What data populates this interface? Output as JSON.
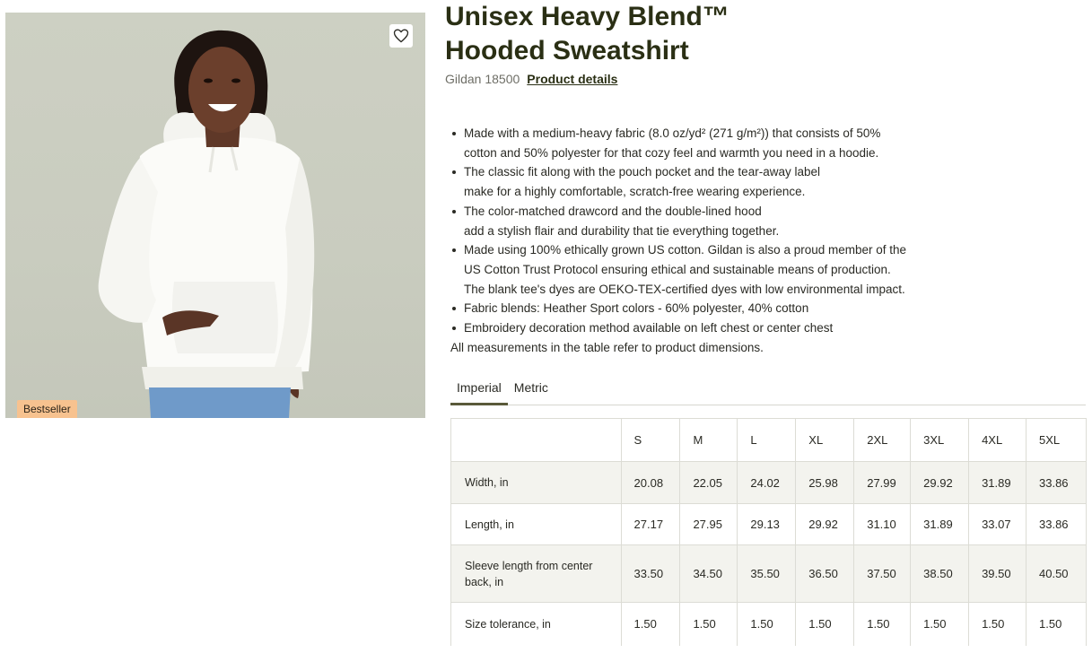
{
  "product": {
    "title_line1": "Unisex Heavy Blend™",
    "title_line2": "Hooded Sweatshirt",
    "brand_model": "Gildan 18500",
    "details_link": "Product details",
    "badge": "Bestseller",
    "favorite_icon": "heart-icon"
  },
  "features": [
    {
      "line1": "Made with a medium-heavy fabric (8.0 oz/yd² (271 g/m²)) that consists of 50%",
      "line2": "cotton and 50% polyester for that cozy feel and warmth you need in a hoodie."
    },
    {
      "line1": "The classic fit along with the pouch pocket and the tear-away label",
      "line2": "make for a highly comfortable, scratch-free wearing experience."
    },
    {
      "line1": "The color-matched drawcord and the double-lined hood",
      "line2": "add a stylish flair and durability that tie everything together."
    },
    {
      "line1": "Made using 100% ethically grown US cotton. Gildan is also a proud member of the",
      "line2": "US Cotton Trust Protocol ensuring ethical and sustainable means of production.",
      "line3": "The blank tee's dyes are OEKO-TEX-certified dyes with low environmental impact."
    },
    {
      "line1": "Fabric blends: Heather Sport colors - 60% polyester, 40% cotton"
    },
    {
      "line1": "Embroidery decoration method available on left chest or center chest"
    }
  ],
  "note": "All measurements in the table refer to product dimensions.",
  "tabs": [
    {
      "label": "Imperial",
      "active": true
    },
    {
      "label": "Metric",
      "active": false
    }
  ],
  "size_table": {
    "columns": [
      "S",
      "M",
      "L",
      "XL",
      "2XL",
      "3XL",
      "4XL",
      "5XL"
    ],
    "rows": [
      {
        "label": "Width, in",
        "values": [
          "20.08",
          "22.05",
          "24.02",
          "25.98",
          "27.99",
          "29.92",
          "31.89",
          "33.86"
        ]
      },
      {
        "label": "Length, in",
        "values": [
          "27.17",
          "27.95",
          "29.13",
          "29.92",
          "31.10",
          "31.89",
          "33.07",
          "33.86"
        ]
      },
      {
        "label": "Sleeve length from center back, in",
        "values": [
          "33.50",
          "34.50",
          "35.50",
          "36.50",
          "37.50",
          "38.50",
          "39.50",
          "40.50"
        ]
      },
      {
        "label": "Size tolerance, in",
        "values": [
          "1.50",
          "1.50",
          "1.50",
          "1.50",
          "1.50",
          "1.50",
          "1.50",
          "1.50"
        ]
      }
    ]
  },
  "colors": {
    "title": "#2a2f14",
    "badge_bg": "#f7c28f",
    "photo_bg": "#c9ccbf",
    "hoodie": "#fbfbf8",
    "table_shade": "#f3f3ee"
  }
}
